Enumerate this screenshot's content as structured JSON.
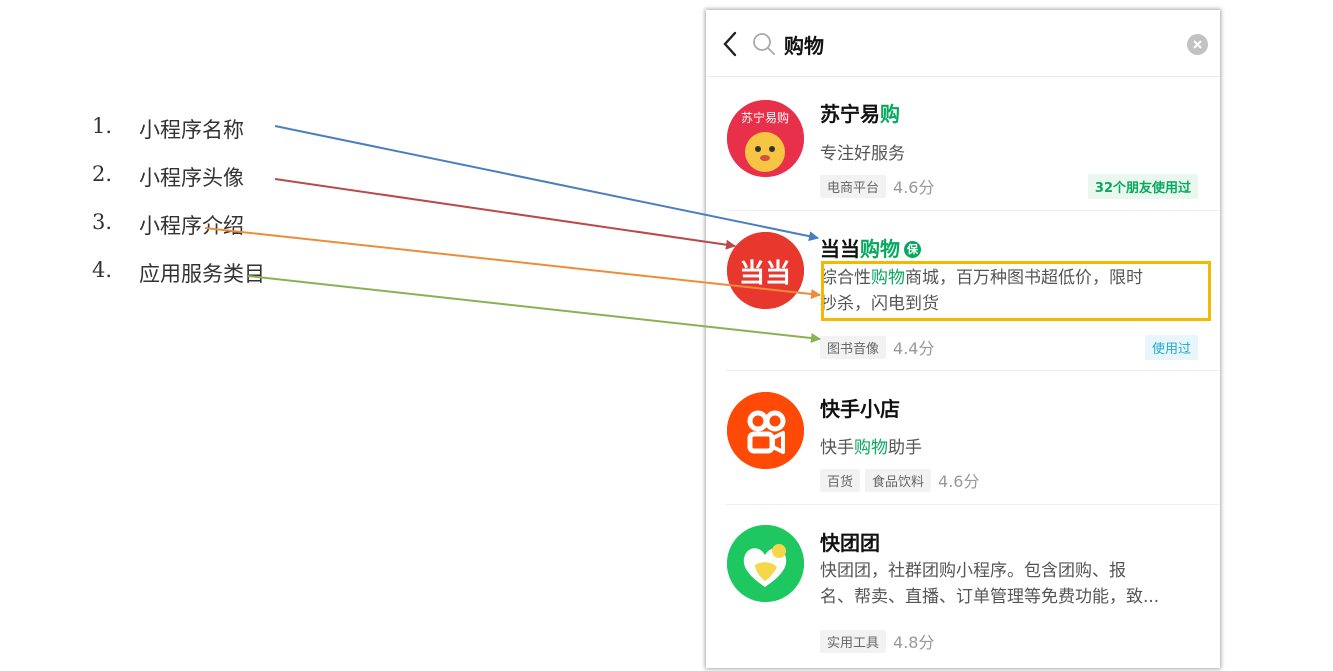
{
  "annotations": [
    {
      "num": "1.",
      "label": "小程序名称",
      "color": "#4a7ec0"
    },
    {
      "num": "2.",
      "label": "小程序头像",
      "color": "#b94a48"
    },
    {
      "num": "3.",
      "label": "小程序介绍",
      "color": "#ee8c3a"
    },
    {
      "num": "4.",
      "label": "应用服务类目",
      "color": "#8ab152"
    }
  ],
  "search": {
    "query": "购物",
    "back_icon": "chevron-left-icon",
    "search_icon": "search-icon",
    "clear_icon": "clear-icon"
  },
  "highlight_color": "#07a85f",
  "box_color": "#f5b800",
  "results": [
    {
      "name_plain": "苏宁易",
      "name_highlight": "购",
      "avatar_text": "苏宁易购",
      "avatar_colors": [
        "#e8304a",
        "#f7c544"
      ],
      "desc_before": "专注好服务",
      "desc_highlight": "",
      "desc_after": "",
      "tags": [
        "电商平台"
      ],
      "score": "4.6分",
      "badge": "32个朋友使用过"
    },
    {
      "name_plain": "当当",
      "name_highlight": "购物",
      "verified": "保",
      "avatar_text": "当当",
      "avatar_colors": [
        "#e8382e"
      ],
      "desc_before": "综合性",
      "desc_highlight": "购物",
      "desc_after": "商城，百万种图书超低价，限时",
      "desc_line2": "抄杀，闪电到货",
      "tags": [
        "图书音像"
      ],
      "score": "4.4分",
      "badge": "使用过"
    },
    {
      "name_plain": "快手小店",
      "name_highlight": "",
      "avatar_colors": [
        "#ff4906"
      ],
      "desc_before": "快手",
      "desc_highlight": "购物",
      "desc_after": "助手",
      "tags": [
        "百货",
        "食品饮料"
      ],
      "score": "4.6分"
    },
    {
      "name_plain": "快团团",
      "name_highlight": "",
      "avatar_colors": [
        "#1ec760",
        "#f6d64a"
      ],
      "desc_before": "快团团，社群团购小程序。包含团购、报",
      "desc_highlight": "",
      "desc_after": "",
      "desc_line2": "名、帮卖、直播、订单管理等免费功能，致...",
      "tags": [
        "实用工具"
      ],
      "score": "4.8分"
    }
  ]
}
